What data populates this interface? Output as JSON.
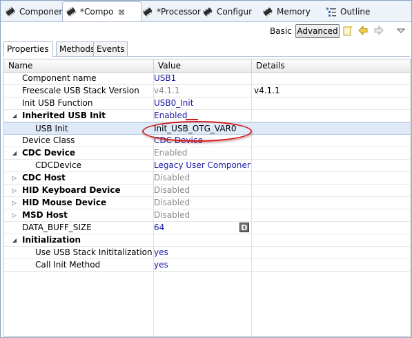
{
  "tabs": [
    {
      "label": "Componen",
      "icon": "component-icon"
    },
    {
      "label": "*Compo",
      "icon": "component-icon",
      "close": "⊠"
    },
    {
      "label": "*Processor",
      "icon": "processor-icon"
    },
    {
      "label": "Configur",
      "icon": "configuration-icon"
    },
    {
      "label": "Memory",
      "icon": "memory-icon"
    },
    {
      "label": "Outline",
      "icon": "outline-icon"
    }
  ],
  "toolbar": {
    "basic_label": "Basic",
    "advanced_label": "Advanced"
  },
  "subtabs": [
    "Properties",
    "Methods",
    "Events"
  ],
  "columns": [
    "Name",
    "Value",
    "Details"
  ],
  "rows": [
    {
      "name": "Component name",
      "value": "USB1",
      "details": ""
    },
    {
      "name": "Freescale USB Stack Version",
      "value": "v4.1.1",
      "details": "v4.1.1"
    },
    {
      "name": "Init USB Function",
      "value": "USB0_Init",
      "details": ""
    },
    {
      "name": "Inherited USB Init",
      "value": "Enabled",
      "details": ""
    },
    {
      "name": "USB Init",
      "value": "Init_USB_OTG_VAR0",
      "details": ""
    },
    {
      "name": "Device Class",
      "value": "CDC Device",
      "details": ""
    },
    {
      "name": "CDC Device",
      "value": "Enabled",
      "details": ""
    },
    {
      "name": "CDCDevice",
      "value": "Legacy User Componen...",
      "details": ""
    },
    {
      "name": "CDC Host",
      "value": "Disabled",
      "details": ""
    },
    {
      "name": "HID Keyboard Device",
      "value": "Disabled",
      "details": ""
    },
    {
      "name": "HID Mouse Device",
      "value": "Disabled",
      "details": ""
    },
    {
      "name": "MSD Host",
      "value": "Disabled",
      "details": ""
    },
    {
      "name": "DATA_BUFF_SIZE",
      "value": "64",
      "details": "",
      "button": "D"
    },
    {
      "name": "Initialization",
      "value": "",
      "details": ""
    },
    {
      "name": "Use USB Stack Inititalization",
      "value": "yes",
      "details": ""
    },
    {
      "name": "Call Init Method",
      "value": "yes",
      "details": ""
    }
  ],
  "annotation_color": "#d21d1d",
  "accent_blue": "#1a1aa6"
}
